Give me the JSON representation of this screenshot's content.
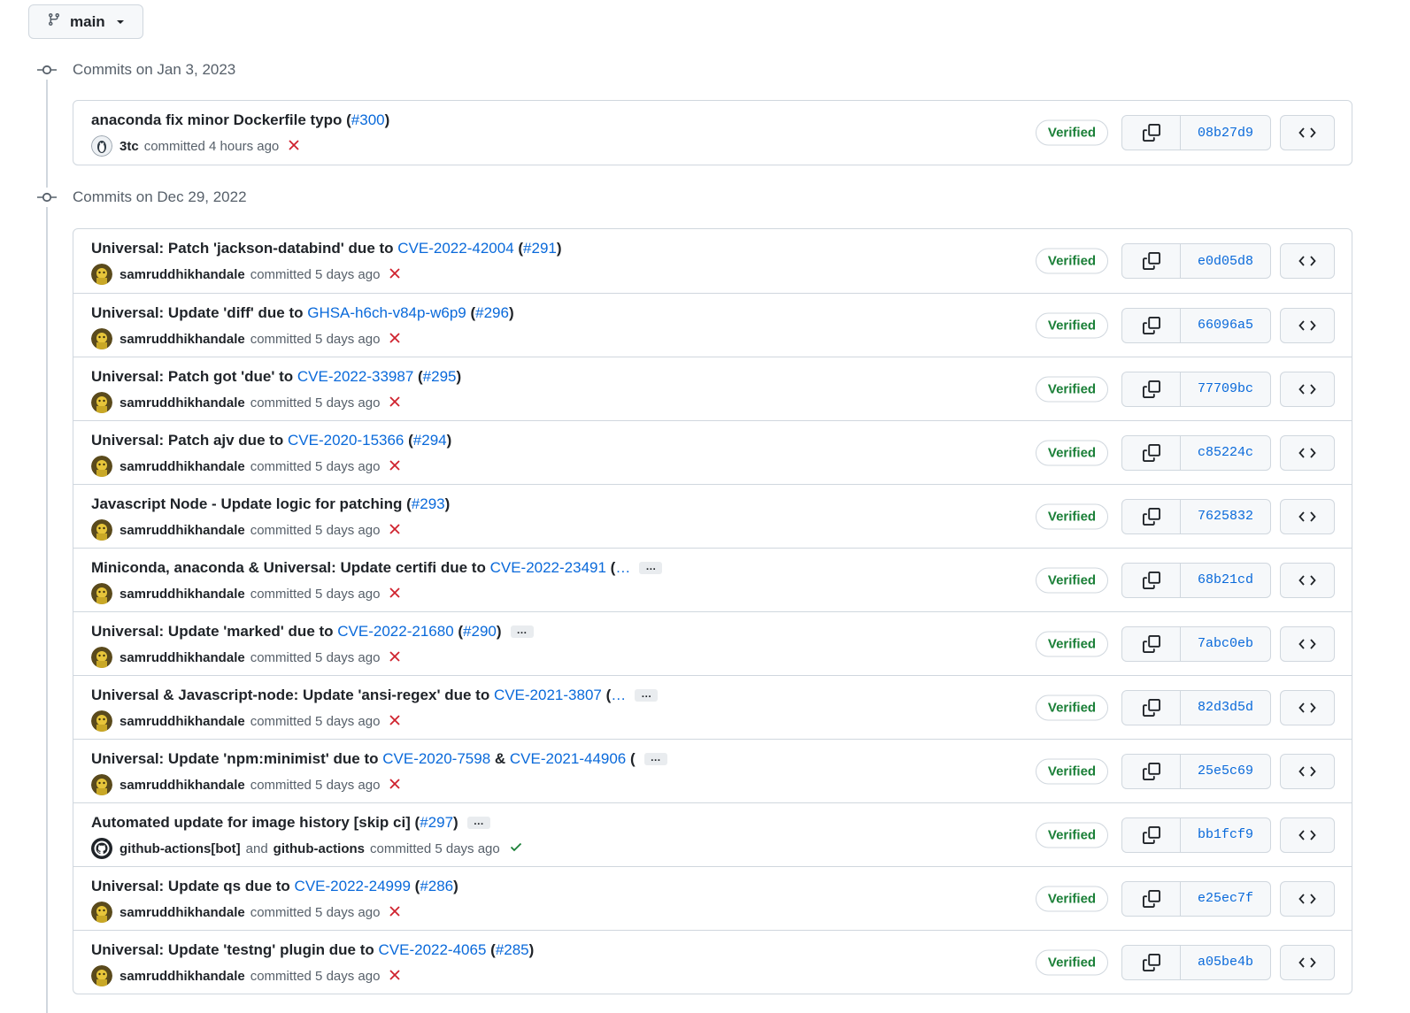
{
  "branch": {
    "label": "main"
  },
  "groups": [
    {
      "heading": "Commits on Jan 3, 2023",
      "commits": [
        {
          "parts": [
            {
              "t": "anaconda fix minor Dockerfile typo ("
            },
            {
              "t": "#300",
              "link": true
            },
            {
              "t": ")"
            }
          ],
          "ellipsis": false,
          "authors": [
            "3tc"
          ],
          "meta_text": "committed 4 hours ago",
          "status": "fail",
          "avatar": "penguin",
          "verified": "Verified",
          "sha": "08b27d9"
        }
      ]
    },
    {
      "heading": "Commits on Dec 29, 2022",
      "commits": [
        {
          "parts": [
            {
              "t": "Universal: Patch 'jackson-databind' due to "
            },
            {
              "t": "CVE-2022-42004",
              "link": true
            },
            {
              "t": " ("
            },
            {
              "t": "#291",
              "link": true
            },
            {
              "t": ")"
            }
          ],
          "ellipsis": false,
          "authors": [
            "samruddhikhandale"
          ],
          "meta_text": "committed 5 days ago",
          "status": "fail",
          "avatar": "yellow",
          "verified": "Verified",
          "sha": "e0d05d8"
        },
        {
          "parts": [
            {
              "t": "Universal: Update 'diff' due to "
            },
            {
              "t": "GHSA-h6ch-v84p-w6p9",
              "link": true
            },
            {
              "t": " ("
            },
            {
              "t": "#296",
              "link": true
            },
            {
              "t": ")"
            }
          ],
          "ellipsis": false,
          "authors": [
            "samruddhikhandale"
          ],
          "meta_text": "committed 5 days ago",
          "status": "fail",
          "avatar": "yellow",
          "verified": "Verified",
          "sha": "66096a5"
        },
        {
          "parts": [
            {
              "t": "Universal: Patch got 'due' to "
            },
            {
              "t": "CVE-2022-33987",
              "link": true
            },
            {
              "t": " ("
            },
            {
              "t": "#295",
              "link": true
            },
            {
              "t": ")"
            }
          ],
          "ellipsis": false,
          "authors": [
            "samruddhikhandale"
          ],
          "meta_text": "committed 5 days ago",
          "status": "fail",
          "avatar": "yellow",
          "verified": "Verified",
          "sha": "77709bc"
        },
        {
          "parts": [
            {
              "t": "Universal: Patch ajv due to "
            },
            {
              "t": "CVE-2020-15366",
              "link": true
            },
            {
              "t": " ("
            },
            {
              "t": "#294",
              "link": true
            },
            {
              "t": ")"
            }
          ],
          "ellipsis": false,
          "authors": [
            "samruddhikhandale"
          ],
          "meta_text": "committed 5 days ago",
          "status": "fail",
          "avatar": "yellow",
          "verified": "Verified",
          "sha": "c85224c"
        },
        {
          "parts": [
            {
              "t": "Javascript Node - Update logic for patching ("
            },
            {
              "t": "#293",
              "link": true
            },
            {
              "t": ")"
            }
          ],
          "ellipsis": false,
          "authors": [
            "samruddhikhandale"
          ],
          "meta_text": "committed 5 days ago",
          "status": "fail",
          "avatar": "yellow",
          "verified": "Verified",
          "sha": "7625832"
        },
        {
          "parts": [
            {
              "t": "Miniconda, anaconda & Universal: Update certifi due to "
            },
            {
              "t": "CVE-2022-23491",
              "link": true
            },
            {
              "t": " ("
            },
            {
              "t": "…",
              "link": true
            }
          ],
          "ellipsis": true,
          "authors": [
            "samruddhikhandale"
          ],
          "meta_text": "committed 5 days ago",
          "status": "fail",
          "avatar": "yellow",
          "verified": "Verified",
          "sha": "68b21cd"
        },
        {
          "parts": [
            {
              "t": "Universal: Update 'marked' due to "
            },
            {
              "t": "CVE-2022-21680",
              "link": true
            },
            {
              "t": " ("
            },
            {
              "t": "#290",
              "link": true
            },
            {
              "t": ")"
            }
          ],
          "ellipsis": true,
          "authors": [
            "samruddhikhandale"
          ],
          "meta_text": "committed 5 days ago",
          "status": "fail",
          "avatar": "yellow",
          "verified": "Verified",
          "sha": "7abc0eb"
        },
        {
          "parts": [
            {
              "t": "Universal & Javascript-node: Update 'ansi-regex' due to "
            },
            {
              "t": "CVE-2021-3807",
              "link": true
            },
            {
              "t": " ("
            },
            {
              "t": "…",
              "link": true
            }
          ],
          "ellipsis": true,
          "authors": [
            "samruddhikhandale"
          ],
          "meta_text": "committed 5 days ago",
          "status": "fail",
          "avatar": "yellow",
          "verified": "Verified",
          "sha": "82d3d5d"
        },
        {
          "parts": [
            {
              "t": "Universal: Update 'npm:minimist' due to "
            },
            {
              "t": "CVE-2020-7598",
              "link": true
            },
            {
              "t": " & "
            },
            {
              "t": "CVE-2021-44906",
              "link": true
            },
            {
              "t": " ("
            }
          ],
          "ellipsis": true,
          "authors": [
            "samruddhikhandale"
          ],
          "meta_text": "committed 5 days ago",
          "status": "fail",
          "avatar": "yellow",
          "verified": "Verified",
          "sha": "25e5c69"
        },
        {
          "parts": [
            {
              "t": "Automated update for image history [skip ci] ("
            },
            {
              "t": "#297",
              "link": true
            },
            {
              "t": ")"
            }
          ],
          "ellipsis": true,
          "authors": [
            "github-actions[bot]",
            "github-actions"
          ],
          "joiner": "and",
          "meta_text": "committed 5 days ago",
          "status": "success",
          "avatar": "github",
          "verified": "Verified",
          "sha": "bb1fcf9"
        },
        {
          "parts": [
            {
              "t": "Universal: Update qs due to "
            },
            {
              "t": "CVE-2022-24999",
              "link": true
            },
            {
              "t": " ("
            },
            {
              "t": "#286",
              "link": true
            },
            {
              "t": ")"
            }
          ],
          "ellipsis": false,
          "authors": [
            "samruddhikhandale"
          ],
          "meta_text": "committed 5 days ago",
          "status": "fail",
          "avatar": "yellow",
          "verified": "Verified",
          "sha": "e25ec7f"
        },
        {
          "parts": [
            {
              "t": "Universal: Update 'testng' plugin due to "
            },
            {
              "t": "CVE-2022-4065",
              "link": true
            },
            {
              "t": " ("
            },
            {
              "t": "#285",
              "link": true
            },
            {
              "t": ")"
            }
          ],
          "ellipsis": false,
          "authors": [
            "samruddhikhandale"
          ],
          "meta_text": "committed 5 days ago",
          "status": "fail",
          "avatar": "yellow",
          "verified": "Verified",
          "sha": "a05be4b"
        }
      ]
    }
  ],
  "colors": {
    "link": "#0969da",
    "success": "#1a7f37",
    "fail": "#cf222e",
    "border": "#d0d7de"
  },
  "icons": {
    "branch": "git-branch-icon",
    "caret": "triangle-down-icon",
    "commit": "git-commit-icon",
    "copy": "copy-icon",
    "browse": "code-icon",
    "fail": "x-icon",
    "success": "check-icon"
  }
}
